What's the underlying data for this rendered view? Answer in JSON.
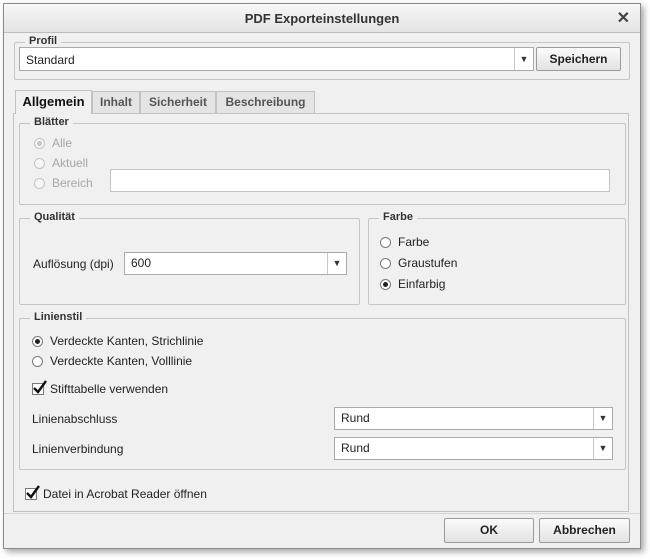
{
  "dialog": {
    "title": "PDF Exporteinstellungen",
    "close_glyph": "✕"
  },
  "profile": {
    "legend": "Profil",
    "value": "Standard",
    "save_label": "Speichern"
  },
  "tabs": [
    {
      "label": "Allgemein",
      "active": true
    },
    {
      "label": "Inhalt",
      "active": false
    },
    {
      "label": "Sicherheit",
      "active": false
    },
    {
      "label": "Beschreibung",
      "active": false
    }
  ],
  "sheets": {
    "legend": "Blätter",
    "options": [
      {
        "label": "Alle",
        "selected": true
      },
      {
        "label": "Aktuell",
        "selected": false
      },
      {
        "label": "Bereich",
        "selected": false
      }
    ],
    "range_value": ""
  },
  "quality": {
    "legend": "Qualität",
    "resolution_label": "Auflösung (dpi)",
    "resolution_value": "600"
  },
  "color": {
    "legend": "Farbe",
    "options": [
      {
        "label": "Farbe",
        "selected": false
      },
      {
        "label": "Graustufen",
        "selected": false
      },
      {
        "label": "Einfarbig",
        "selected": true
      }
    ]
  },
  "linestyle": {
    "legend": "Linienstil",
    "hidden_edges": [
      {
        "label": "Verdeckte Kanten, Strichlinie",
        "selected": true
      },
      {
        "label": "Verdeckte Kanten, Volllinie",
        "selected": false
      }
    ],
    "pen_table_label": "Stifttabelle verwenden",
    "pen_table_checked": true,
    "line_cap_label": "Linienabschluss",
    "line_cap_value": "Rund",
    "line_join_label": "Linienverbindung",
    "line_join_value": "Rund"
  },
  "open_acrobat": {
    "label": "Datei in Acrobat Reader öffnen",
    "checked": true
  },
  "footer": {
    "ok_label": "OK",
    "cancel_label": "Abbrechen"
  },
  "icons": {
    "dropdown": "▼",
    "checkmark": "check-icon"
  }
}
